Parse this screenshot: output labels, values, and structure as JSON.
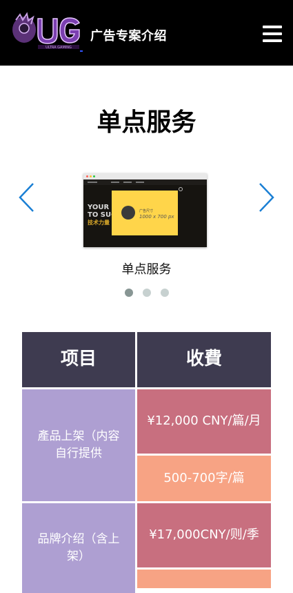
{
  "header": {
    "logo_text": "UG",
    "logo_subtext": "ULTRA GAMING",
    "title": "广告专案介绍",
    "menu_icon": "hamburger-icon"
  },
  "section": {
    "title": "单点服务"
  },
  "carousel": {
    "prev_icon": "chevron-left-icon",
    "next_icon": "chevron-right-icon",
    "slide": {
      "caption": "单点服务",
      "bg_text_line1": "YOUR SHI",
      "bg_text_line2": "TO SUC",
      "bg_text_line3": "技术力量",
      "ad_label": "广告尺寸",
      "ad_size": "1000 x 700 px"
    },
    "slide_count": 3,
    "active_index": 0
  },
  "pricing": {
    "headers": [
      "项目",
      "收費"
    ],
    "rows": [
      {
        "item": "產品上架（内容自行提供",
        "fees": [
          "¥12,000 CNY/篇/月",
          "500-700字/篇"
        ]
      },
      {
        "item": "品牌介绍（含上架）",
        "fees": [
          "¥17,000CNY/则/季",
          ""
        ]
      }
    ]
  },
  "colors": {
    "topbar": "#000000",
    "arrow": "#1a7fd4",
    "table_header": "#3e3b50",
    "item_cell": "#ae9fd2",
    "fee_cell": "#c86f7f",
    "fee_cell_alt": "#f7a384"
  }
}
